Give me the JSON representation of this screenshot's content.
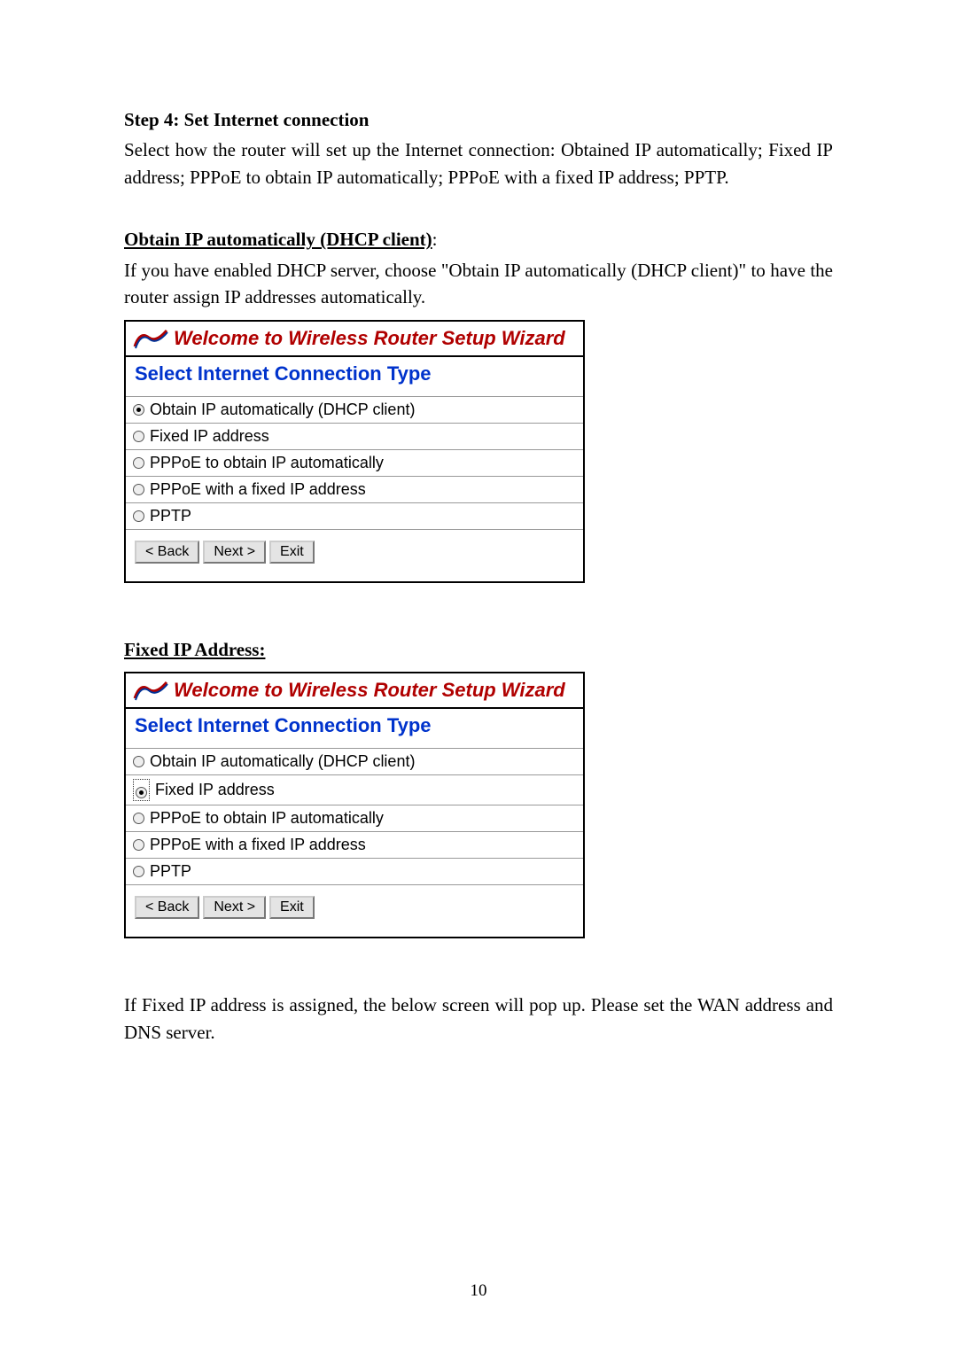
{
  "step4": {
    "title": "Step 4: Set Internet connection",
    "desc": "Select how the router will set up the Internet connection: Obtained IP automatically; Fixed IP address; PPPoE to obtain IP automatically; PPPoE with a fixed IP address; PPTP."
  },
  "obtain_section": {
    "heading": "Obtain IP automatically (DHCP client)",
    "colon": ":",
    "desc": "If you have enabled DHCP server, choose \"Obtain IP automatically (DHCP client)\" to have the router assign IP addresses automatically."
  },
  "wizard": {
    "title": "Welcome to Wireless Router Setup Wizard",
    "subtitle": "Select Internet Connection Type",
    "options": [
      "Obtain IP automatically (DHCP client)",
      "Fixed IP address",
      "PPPoE to obtain IP automatically",
      "PPPoE with a fixed IP address",
      "PPTP"
    ],
    "buttons": {
      "back": "< Back",
      "next": "Next >",
      "exit": "Exit"
    }
  },
  "fixed_section": {
    "heading": "Fixed IP Address:",
    "desc": "If Fixed IP address is assigned, the below screen will pop up.   Please set the WAN address and DNS server."
  },
  "page_number": "10"
}
